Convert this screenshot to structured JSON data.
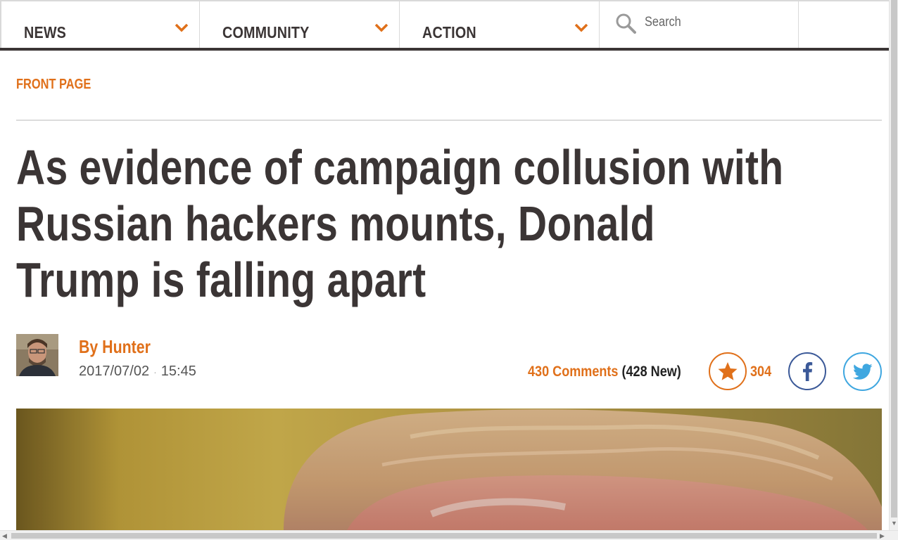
{
  "nav": {
    "items": [
      {
        "label": "NEWS"
      },
      {
        "label": "COMMUNITY"
      },
      {
        "label": "ACTION"
      }
    ],
    "search": {
      "placeholder": "Search"
    }
  },
  "colors": {
    "accent": "#e0701a",
    "dark_text": "#3b3535",
    "facebook": "#3b5998",
    "twitter": "#3fa7e0"
  },
  "breadcrumb": "FRONT PAGE",
  "article": {
    "headline_lines": [
      "As evidence of campaign collusion with",
      "Russian hackers mounts, Donald",
      "Trump is falling apart"
    ],
    "author": "By Hunter",
    "date": "2017/07/02",
    "time": "15:45",
    "date_separator": "·",
    "comments_count": "430 Comments",
    "comments_new": "(428 New)",
    "recommend_count": "304"
  },
  "icons": {
    "nav_chevron": "chevron-down-icon",
    "search": "search-icon",
    "recommend": "star-icon",
    "facebook": "facebook-icon",
    "twitter": "twitter-icon"
  }
}
